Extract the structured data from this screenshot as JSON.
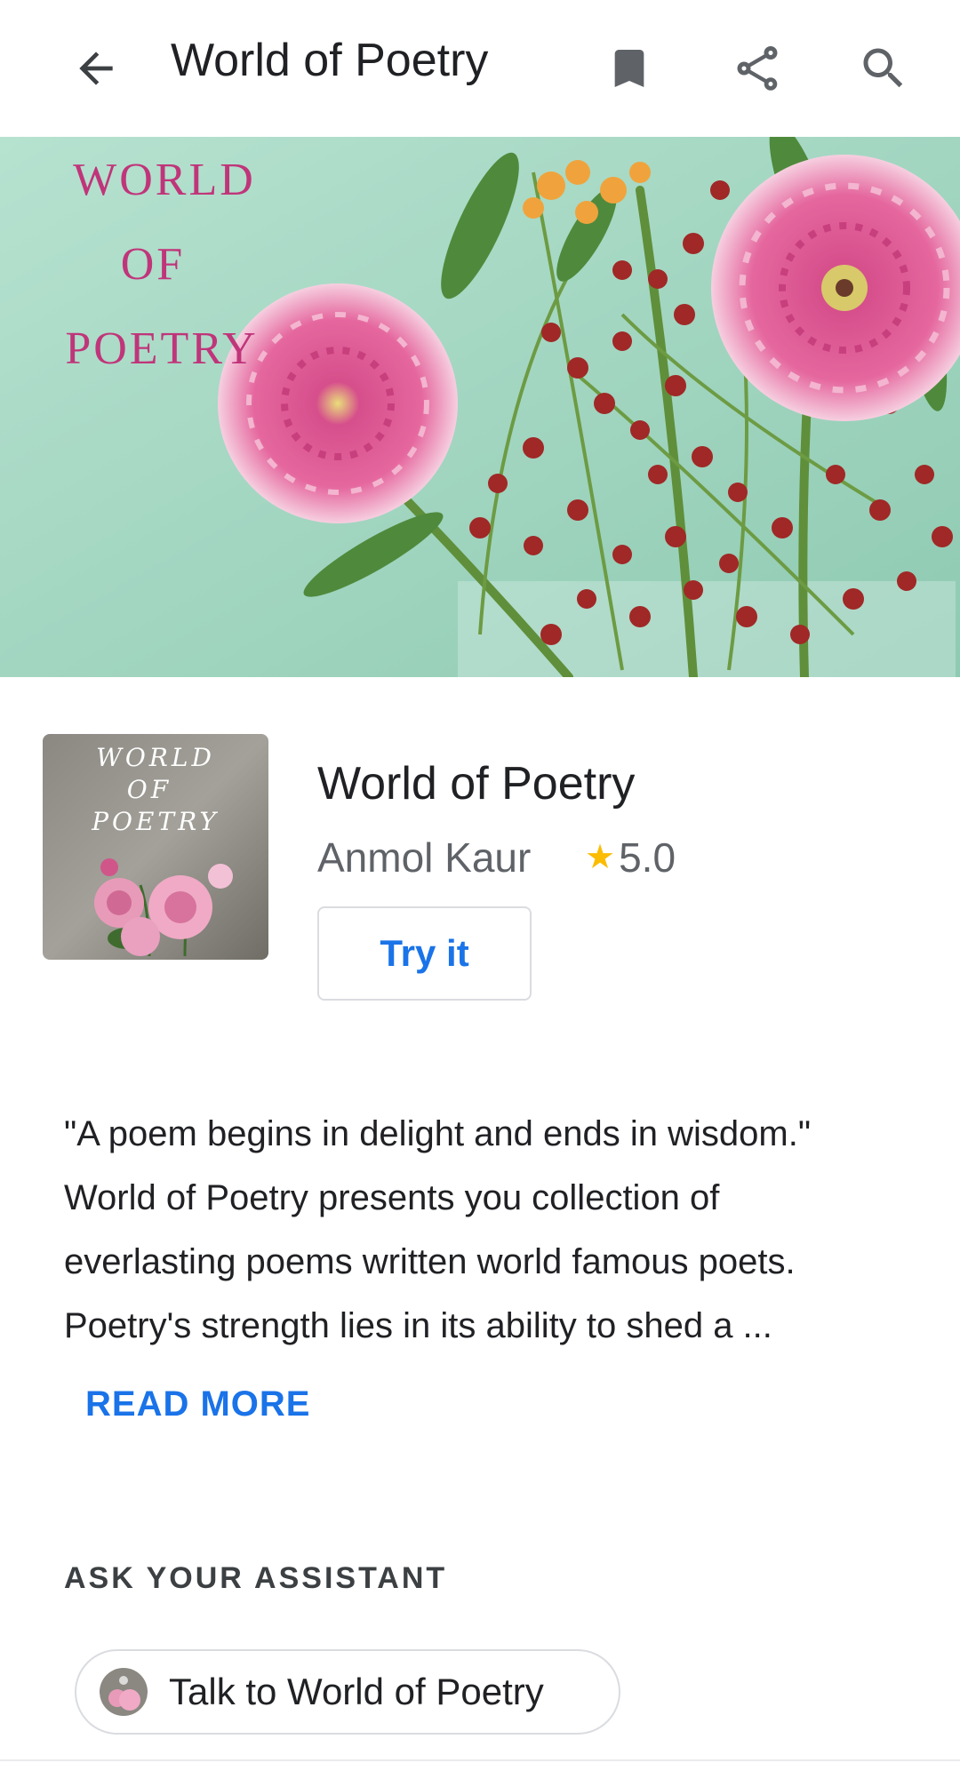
{
  "appbar": {
    "title": "World of Poetry",
    "back_icon": "arrow-back-icon",
    "bookmark_icon": "bookmark-icon",
    "share_icon": "share-icon",
    "search_icon": "search-icon"
  },
  "banner": {
    "lines": [
      "WORLD",
      "OF",
      "POETRY"
    ],
    "text_color": "#c0357a",
    "background": "#a7d8c4"
  },
  "thumbnail": {
    "lines": [
      "WORLD",
      "OF",
      "POETRY"
    ]
  },
  "app": {
    "title": "World of Poetry",
    "author": "Anmol Kaur",
    "rating": "5.0",
    "rating_icon": "star-icon",
    "try_label": "Try it"
  },
  "description": {
    "lines": [
      "\"A poem begins in delight and ends in wisdom.\"",
      "World of Poetry presents you collection of",
      "everlasting poems written world famous poets.",
      "Poetry's strength lies in its ability to shed a ..."
    ],
    "read_more_label": "READ MORE"
  },
  "assistant": {
    "section_label": "ASK YOUR ASSISTANT",
    "chip_label": "Talk to World of Poetry"
  },
  "colors": {
    "accent": "#1a73e8",
    "star": "#fbbc04",
    "text_primary": "#202124",
    "text_secondary": "#5f6368"
  }
}
